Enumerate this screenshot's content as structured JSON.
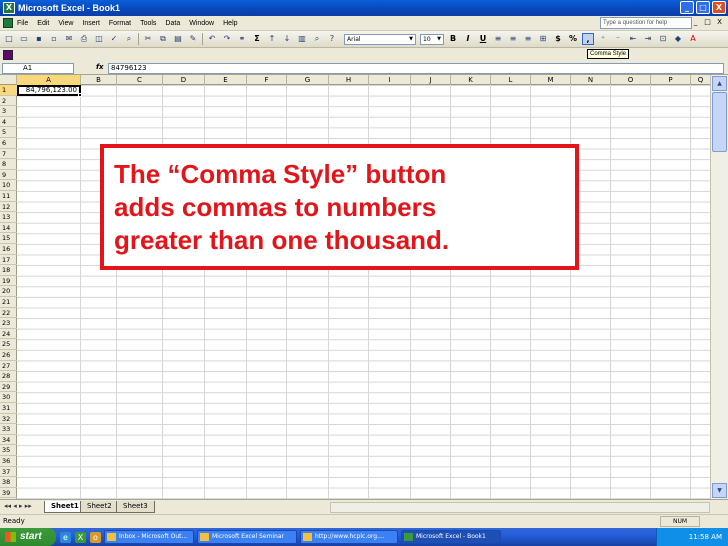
{
  "window": {
    "title": "Microsoft Excel - Book1",
    "buttons": [
      "_",
      "□",
      "X"
    ]
  },
  "menu": {
    "items": [
      "File",
      "Edit",
      "View",
      "Insert",
      "Format",
      "Tools",
      "Data",
      "Window",
      "Help"
    ],
    "question_placeholder": "Type a question for help",
    "doc_controls": [
      "_",
      "□",
      "X"
    ]
  },
  "toolbar": {
    "font_name": "Arial",
    "font_size": "10",
    "bold": "B",
    "italic": "I",
    "underline": "U",
    "sum": "Σ",
    "currency": "$",
    "percent": "%",
    "comma": ",",
    "tooltip": "Comma Style"
  },
  "formula_bar": {
    "name_box": "A1",
    "fx": "fx",
    "formula": "84796123"
  },
  "grid": {
    "columns": [
      "A",
      "B",
      "C",
      "D",
      "E",
      "F",
      "G",
      "H",
      "I",
      "J",
      "K",
      "L",
      "M",
      "N",
      "O",
      "P",
      "Q"
    ],
    "rows": [
      "1",
      "2",
      "3",
      "4",
      "5",
      "6",
      "7",
      "8",
      "9",
      "10",
      "11",
      "12",
      "13",
      "14",
      "15",
      "16",
      "17",
      "18",
      "19",
      "20",
      "21",
      "22",
      "23",
      "24",
      "25",
      "26",
      "27",
      "28",
      "29",
      "30",
      "31",
      "32",
      "33",
      "34",
      "35",
      "36",
      "37",
      "38",
      "39"
    ],
    "a1_value": "84,796,123.00"
  },
  "sheets": {
    "tabs": [
      "Sheet1",
      "Sheet2",
      "Sheet3"
    ],
    "nav": "◂◂ ◂ ▸ ▸▸"
  },
  "status": {
    "text": "Ready",
    "num": "NUM"
  },
  "taskbar": {
    "start": "start",
    "items": [
      "Inbox - Microsoft Out...",
      "Microsoft Excel Seminar",
      "http://www.hcplc.org....",
      "Microsoft Excel - Book1"
    ],
    "time": "11:58 AM"
  },
  "callout": {
    "text": "The “Comma Style” button\nadds commas to numbers\ngreater than one thousand."
  },
  "colors": {
    "callout_red": "#e3151a",
    "title_blue": "#0a5fd8",
    "start_green": "#3c9a3c"
  }
}
